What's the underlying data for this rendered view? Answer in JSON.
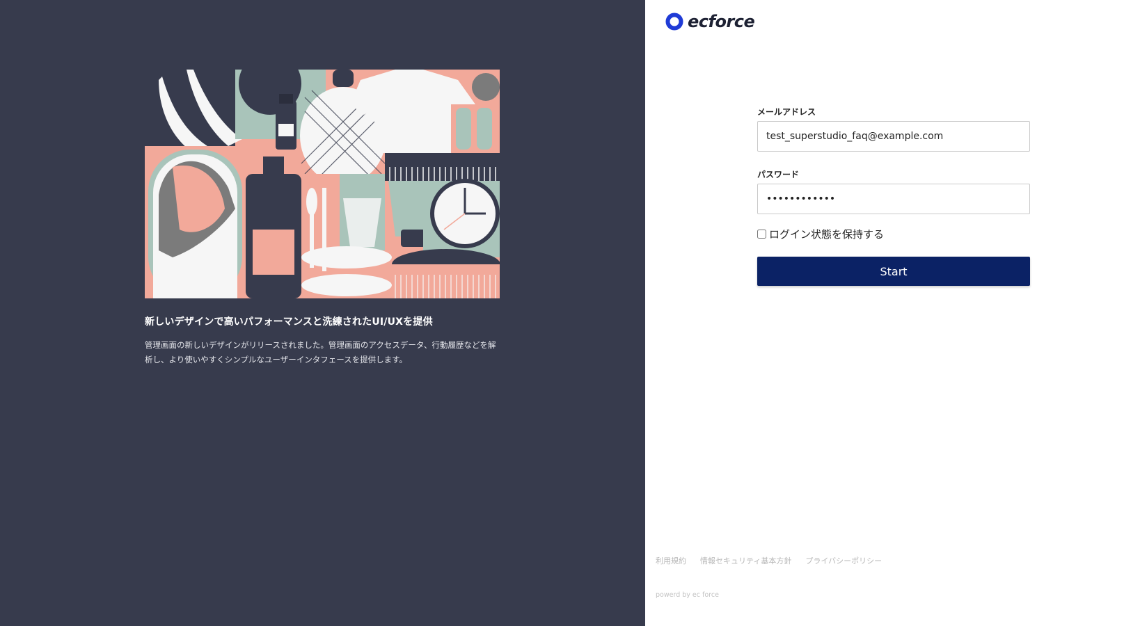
{
  "brand": {
    "name": "ecforce",
    "colors": {
      "left_background": "#373b4d",
      "primary_button": "#0b2265",
      "logo_ring": "#1f3bd6"
    }
  },
  "announcement": {
    "title": "新しいデザインで高いパフォーマンスと洗練されたUI/UXを提供",
    "description": "管理画面の新しいデザインがリリースされました。管理画面のアクセスデータ、行動履歴などを解析し、より使いやすくシンプルなユーザーインタフェースを提供します。"
  },
  "login_form": {
    "email": {
      "label": "メールアドレス",
      "value": "test_superstudio_faq@example.com"
    },
    "password": {
      "label": "パスワード",
      "value": "••••••••••••"
    },
    "remember": {
      "label": "ログイン状態を保持する",
      "checked": false
    },
    "submit_label": "Start"
  },
  "footer": {
    "links": [
      {
        "label": "利用規約"
      },
      {
        "label": "情報セキュリティ基本方針"
      },
      {
        "label": "プライバシーポリシー"
      }
    ],
    "powered_by": "powerd by ec force"
  }
}
